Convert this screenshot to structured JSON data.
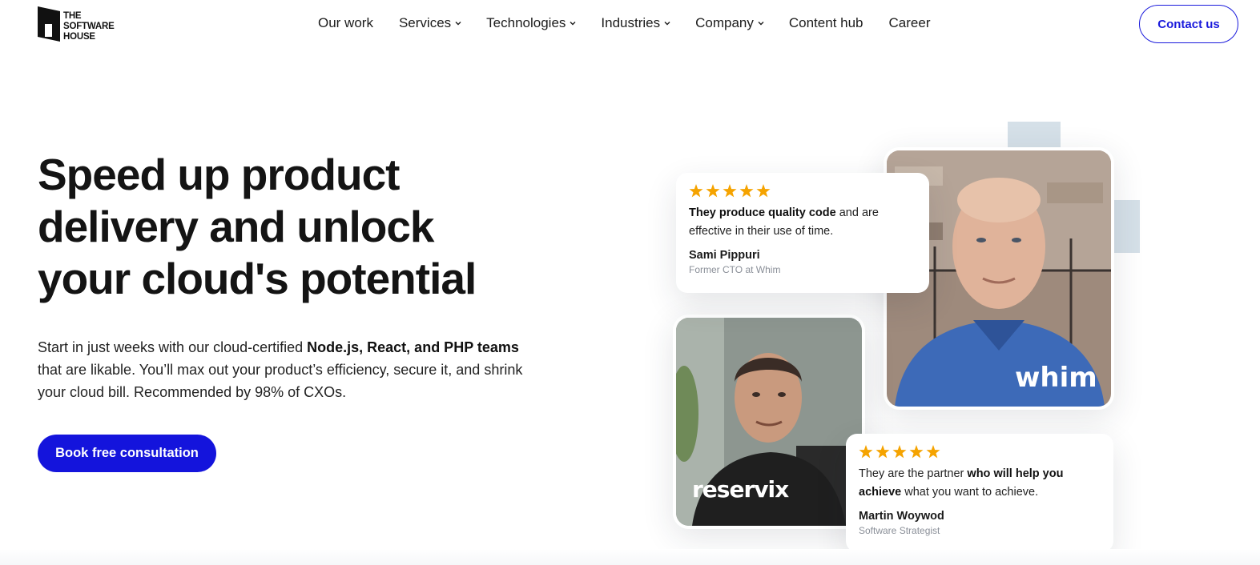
{
  "brand": {
    "logo_lines": [
      "THE",
      "SOFTWARE",
      "HOUSE"
    ]
  },
  "nav": {
    "items": [
      {
        "label": "Our work",
        "has_dropdown": false
      },
      {
        "label": "Services",
        "has_dropdown": true
      },
      {
        "label": "Technologies",
        "has_dropdown": true
      },
      {
        "label": "Industries",
        "has_dropdown": true
      },
      {
        "label": "Company",
        "has_dropdown": true
      },
      {
        "label": "Content hub",
        "has_dropdown": false
      },
      {
        "label": "Career",
        "has_dropdown": false
      }
    ],
    "contact_label": "Contact us"
  },
  "hero": {
    "title_lines": [
      "Speed up product",
      "delivery and unlock",
      "your cloud's potential"
    ],
    "text": {
      "part1": "Start in just weeks with our cloud-certified ",
      "bold1": "Node.js, React, and PHP teams",
      "part2": " that are likable. You’ll max out your product’s efficiency, secure it, and shrink your cloud bill. Recommended by 98% of CXOs."
    },
    "cta_label": "Book free consultation"
  },
  "testimonials": [
    {
      "rating": 5,
      "quote_bold_start": "They produce quality code",
      "quote_rest": " and are effective in their use of time.",
      "author": "Sami Pippuri",
      "role": "Former CTO at Whim",
      "photo_brand": "whim"
    },
    {
      "rating": 5,
      "quote_start": "They are the partner ",
      "quote_bold": "who will help you achieve",
      "quote_rest": " what you want to achieve.",
      "author": "Martin Woywod",
      "role": "Software Strategist",
      "photo_brand": "reservix"
    }
  ],
  "colors": {
    "accent": "#1414dc",
    "star": "#f5a300",
    "text_dark": "#141414",
    "deco": "#d5e0e8"
  },
  "icons": {
    "dropdown": "chevron-down-icon",
    "rating": "star-icon"
  }
}
